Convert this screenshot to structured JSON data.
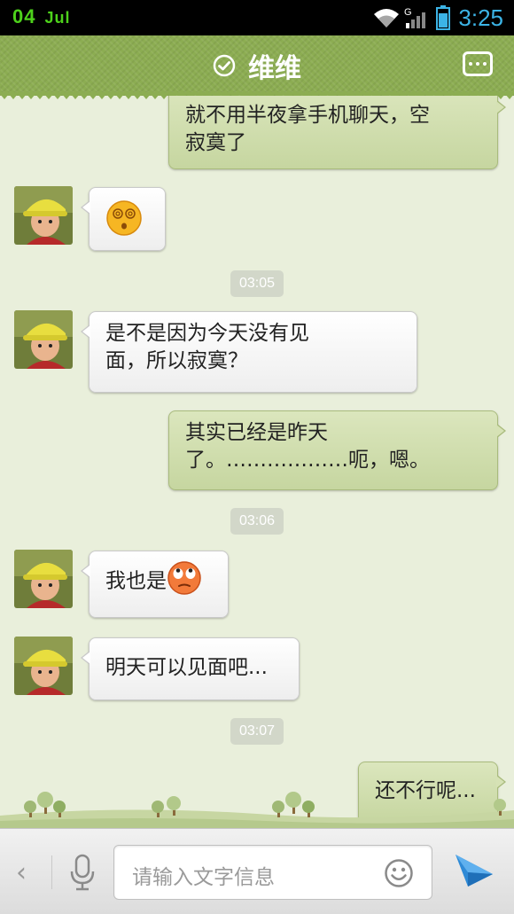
{
  "status_bar": {
    "date_day": "04",
    "date_month": "Jul",
    "time": "3:25",
    "network_label": "G"
  },
  "header": {
    "title": "维维"
  },
  "messages": [
    {
      "type": "out",
      "lines": [
        "就不用半夜拿手机聊天，空",
        "寂寞了"
      ]
    },
    {
      "type": "in",
      "emoji": "dizzy-face-emoji"
    },
    {
      "type": "time",
      "text": "03:05"
    },
    {
      "type": "in",
      "lines": [
        "是不是因为今天没有见",
        "面，所以寂寞？"
      ]
    },
    {
      "type": "out",
      "lines": [
        "其实已经是昨天",
        "了。………………呃，嗯。"
      ]
    },
    {
      "type": "time",
      "text": "03:06"
    },
    {
      "type": "in",
      "text": "我也是",
      "emoji": "eye-roll-emoji"
    },
    {
      "type": "in",
      "text": "明天可以见面吧..."
    },
    {
      "type": "time",
      "text": "03:07"
    },
    {
      "type": "out",
      "text": "还不行呢..."
    }
  ],
  "input_bar": {
    "placeholder": "请输入文字信息"
  },
  "colors": {
    "header": "#8cad52",
    "chat_bg": "#e9efdb",
    "time_green": "#4dd11b",
    "clock_blue": "#3cb4e6"
  }
}
